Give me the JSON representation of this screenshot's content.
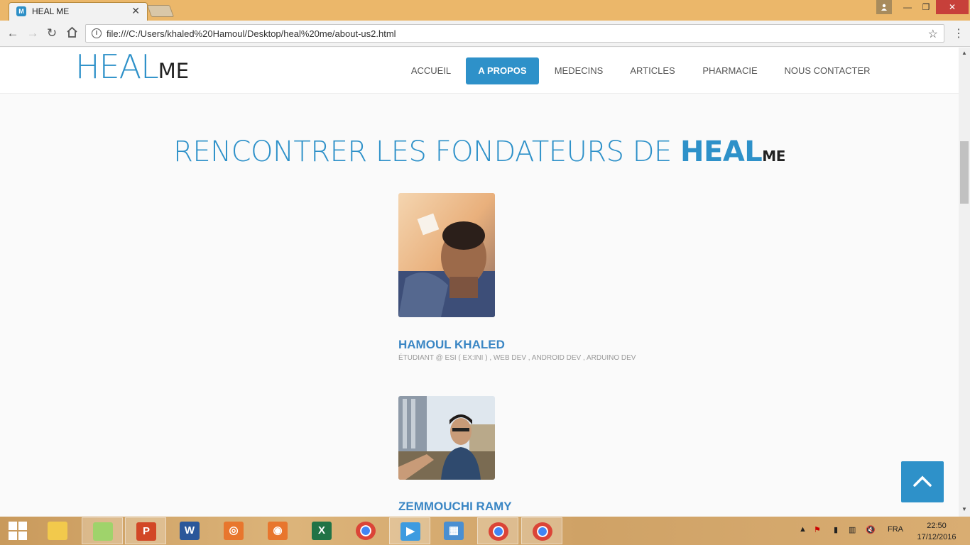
{
  "browser": {
    "tab_title": "HEAL ME",
    "tab_favicon_letter": "M",
    "url": "file:///C:/Users/khaled%20Hamoul/Desktop/heal%20me/about-us2.html"
  },
  "site": {
    "logo_heal": "HEAL",
    "logo_me": "ME",
    "nav": [
      "ACCUEIL",
      "A PROPOS",
      "MEDECINS",
      "ARTICLES",
      "PHARMACIE",
      "NOUS CONTACTER"
    ],
    "active_nav": "A PROPOS",
    "accent_color": "#2e91c9"
  },
  "main": {
    "title_prefix": "RENCONTRER LES FONDATEURS DE ",
    "title_heal": "HEAL",
    "title_me": "ME",
    "members": [
      {
        "name": "HAMOUL KHALED",
        "description": "ÉTUDIANT @ ESI ( EX:INI ) , WEB DEV , ANDROID DEV , ARDUINO DEV"
      },
      {
        "name": "ZEMMOUCHI RAMY",
        "description": ""
      }
    ]
  },
  "taskbar": {
    "apps": [
      "windows-start",
      "file-explorer",
      "notes",
      "powerpoint",
      "word",
      "camera-app",
      "screenshot-app",
      "excel",
      "chrome",
      "media-player",
      "control-panel",
      "chrome",
      "chrome"
    ],
    "tray_lang": "FRA",
    "time": "22:50",
    "date": "17/12/2016"
  }
}
